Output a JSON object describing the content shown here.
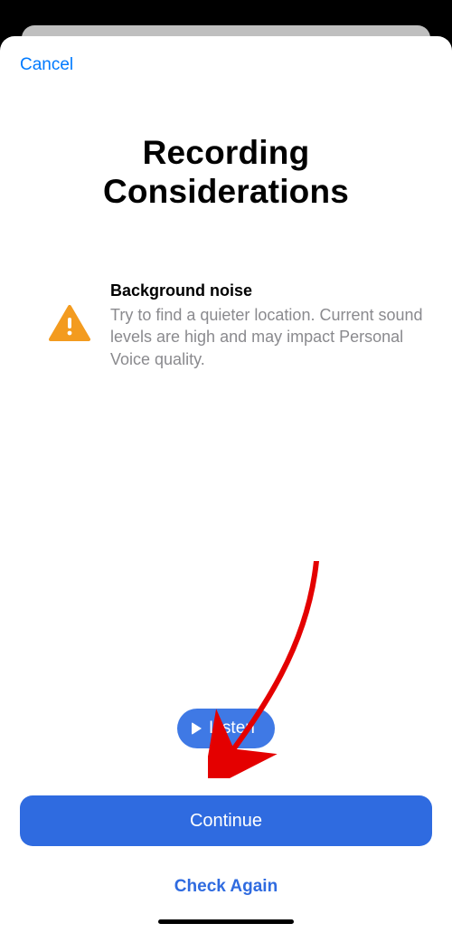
{
  "nav": {
    "cancel_label": "Cancel"
  },
  "page": {
    "title_line1": "Recording",
    "title_line2": "Considerations"
  },
  "info": {
    "heading": "Background noise",
    "body": "Try to find a quieter location. Current sound levels are high and may impact Personal Voice quality."
  },
  "buttons": {
    "listen_label": "Listen",
    "continue_label": "Continue",
    "check_again_label": "Check Again"
  },
  "icons": {
    "warning": "warning-triangle",
    "play": "play"
  },
  "colors": {
    "accent": "#007aff",
    "primary_button": "#2f6be0",
    "warning_icon": "#f39b1f",
    "body_text_muted": "#8a8a8e"
  }
}
